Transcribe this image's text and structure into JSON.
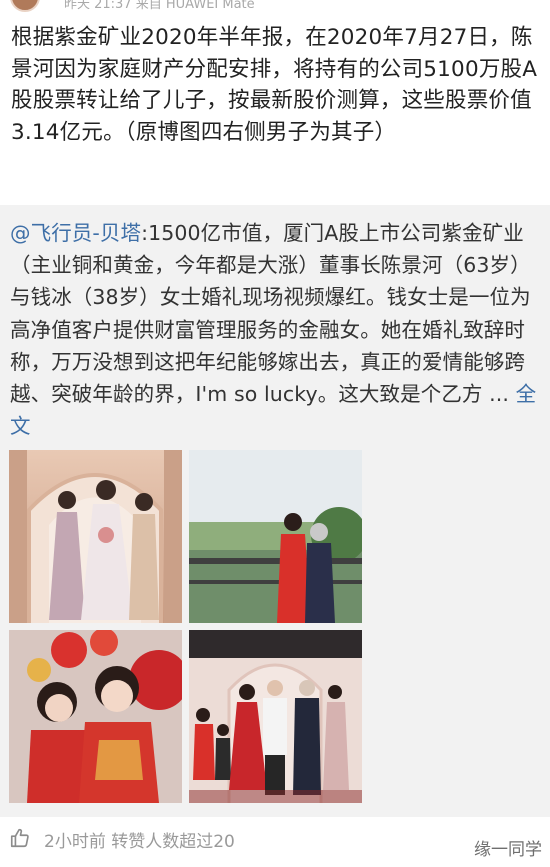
{
  "header": {
    "meta_text": "昨天 21:37  来自 HUAWEI Mate"
  },
  "post": {
    "text": "根据紫金矿业2020年半年报，在2020年7月27日，陈景河因为家庭财产分配安排，将持有的公司5100万股A股股票转让给了儿子，按最新股价测算，这些股票价值3.14亿元。（原博图四右侧男子为其子）"
  },
  "retweet": {
    "mention": "@飞行员-贝塔",
    "body": ":1500亿市值，厦门A股上市公司紫金矿业（主业铜和黄金，今年都是大涨）董事长陈景河（63岁）与钱冰（38岁）女士婚礼现场视频爆红。钱女士是一位为高净值客户提供财富管理服务的金融女。她在婚礼致辞时称，万万没想到这把年纪能够嫁出去，真正的爱情能够跨越、突破年龄的界，I'm so lucky。这大致是个乙方 ... ",
    "more_label": "全文"
  },
  "photos": [
    {
      "name": "bridesmaids-photo"
    },
    {
      "name": "outdoor-couple-photo"
    },
    {
      "name": "bride-portrait-photo"
    },
    {
      "name": "family-group-photo"
    }
  ],
  "footer": {
    "like_icon": "thumbs-up-icon",
    "status_text": "2小时前 转赞人数超过20",
    "watermark": "缘一同学"
  }
}
